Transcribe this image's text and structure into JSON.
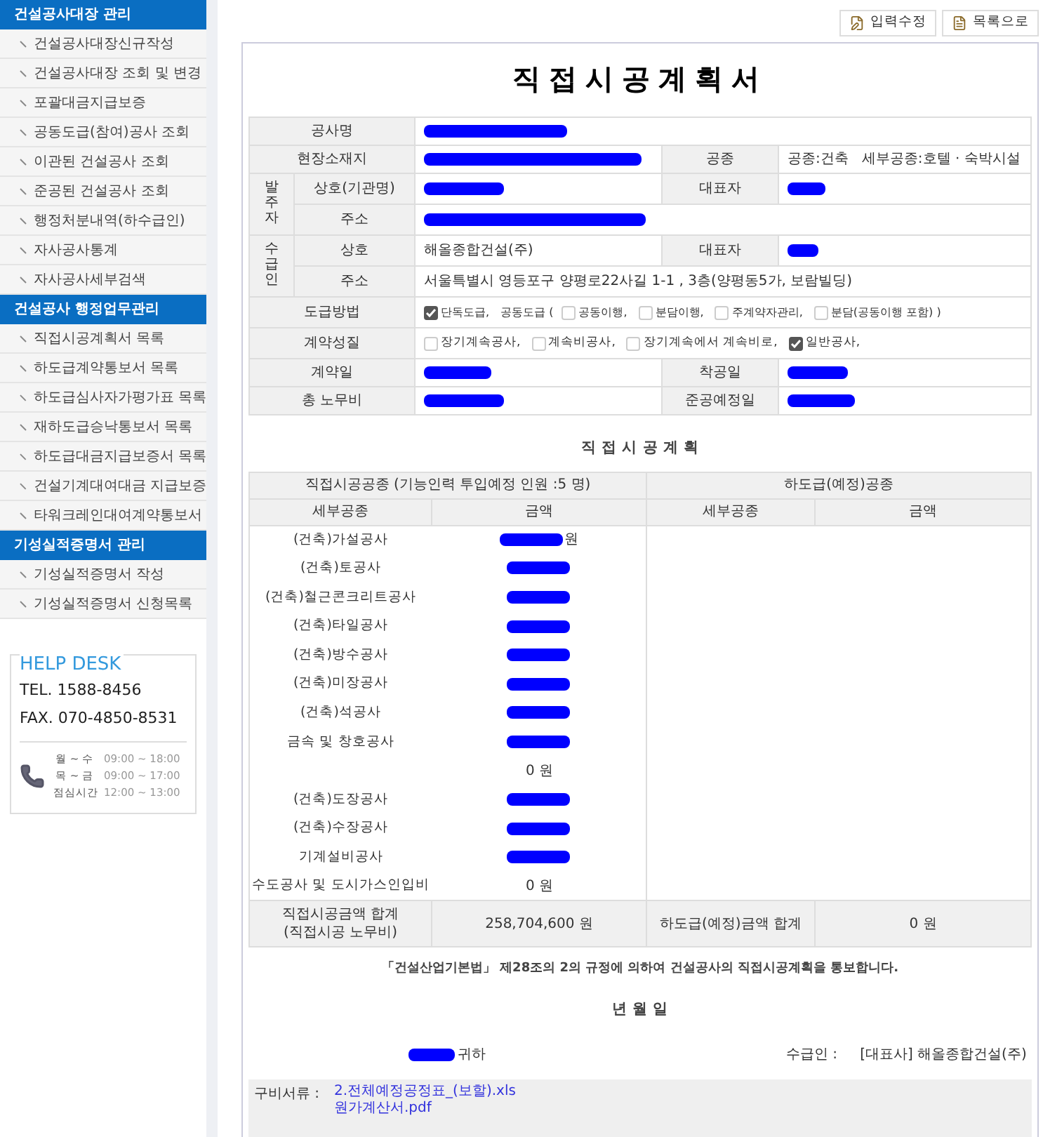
{
  "sidebar": {
    "sections": [
      {
        "title": "건설공사대장 관리",
        "items": [
          {
            "label": "건설공사대장신규작성"
          },
          {
            "label": "건설공사대장 조회 및 변경"
          },
          {
            "label": "포괄대금지급보증"
          },
          {
            "label": "공동도급(참여)공사 조회"
          },
          {
            "label": "이관된 건설공사 조회"
          },
          {
            "label": "준공된 건설공사 조회"
          },
          {
            "label": "행정처분내역(하수급인)"
          },
          {
            "label": "자사공사통계"
          },
          {
            "label": "자사공사세부검색"
          }
        ]
      },
      {
        "title": "건설공사 행정업무관리",
        "items": [
          {
            "label": "직접시공계획서 목록"
          },
          {
            "label": "하도급계약통보서 목록"
          },
          {
            "label": "하도급심사자가평가표 목록"
          },
          {
            "label": "재하도급승낙통보서 목록"
          },
          {
            "label": "하도급대금지급보증서 목록"
          },
          {
            "label": "건설기계대여대금 지급보증"
          },
          {
            "label": "타워크레인대여계약통보서"
          }
        ]
      },
      {
        "title": "기성실적증명서 관리",
        "items": [
          {
            "label": "기성실적증명서 작성"
          },
          {
            "label": "기성실적증명서 신청목록"
          }
        ]
      }
    ]
  },
  "help_desk": {
    "title": "HELP DESK",
    "tel": "TEL. 1588-8456",
    "fax": "FAX. 070-4850-8531",
    "hours": [
      {
        "days": "월 ~ 수",
        "time": "09:00 ~ 18:00"
      },
      {
        "days": "목 ~ 금",
        "time": "09:00 ~ 17:00"
      },
      {
        "days": "점심시간",
        "time": "12:00 ~ 13:00"
      }
    ]
  },
  "toolbar": {
    "buttons": [
      {
        "kind": "edit",
        "label": "입력수정"
      },
      {
        "kind": "list",
        "label": "목록으로"
      }
    ]
  },
  "document": {
    "title": "직접시공계획서",
    "info": {
      "project_name": {
        "label": "공사명"
      },
      "site": {
        "label": "현장소재지"
      },
      "work_type": {
        "label": "공종",
        "value": "공종:건축   세부공종:호텔 · 숙박시설"
      },
      "orderer": {
        "group": "발주자",
        "name_label": "상호(기관명)",
        "rep_label": "대표자",
        "address_label": "주소"
      },
      "contractor": {
        "group": "수급인",
        "name_label": "상호",
        "name": "해올종합건설(주)",
        "rep_label": "대표자",
        "address_label": "주소",
        "address": "서울특별시 영등포구 양평로22사길 1-1 , 3층(양평동5가, 보람빌딩)"
      },
      "contract_method": {
        "label": "도급방법",
        "options": [
          {
            "kind": "checkbox",
            "label": "단독도급,",
            "checked": true
          },
          {
            "kind": "text",
            "label": "공동도급 ("
          },
          {
            "kind": "checkbox",
            "label": "공동이행,",
            "checked": false
          },
          {
            "kind": "checkbox",
            "label": "분담이행,",
            "checked": false
          },
          {
            "kind": "checkbox",
            "label": "주계약자관리,",
            "checked": false
          },
          {
            "kind": "checkbox",
            "label": "분담(공동이행 포함) )",
            "checked": false
          }
        ]
      },
      "contract_nature": {
        "label": "계약성질",
        "options": [
          {
            "kind": "checkbox",
            "label": "장기계속공사,",
            "checked": false
          },
          {
            "kind": "checkbox",
            "label": "계속비공사,",
            "checked": false
          },
          {
            "kind": "checkbox",
            "label": "장기계속에서 계속비로,",
            "checked": false
          },
          {
            "kind": "checkbox",
            "label": "일반공사,",
            "checked": true
          }
        ]
      },
      "contract_date": {
        "label": "계약일"
      },
      "start_date": {
        "label": "착공일"
      },
      "labor_cost": {
        "label": "총 노무비"
      },
      "completion_date": {
        "label": "준공예정일"
      }
    },
    "plan": {
      "title": "직 접 시 공 계 획",
      "direct_header": "직접시공공종 (기능인력 투입예정 인원 :5 명)",
      "sub_header": "하도급(예정)공종",
      "columns": [
        "세부공종",
        "금액",
        "세부공종",
        "금액"
      ],
      "rows": [
        {
          "trade": "(건축)가설공사",
          "redacted": true,
          "amount": "원"
        },
        {
          "trade": "(건축)토공사",
          "redacted": true
        },
        {
          "trade": "(건축)철근콘크리트공사",
          "redacted": true
        },
        {
          "trade": "(건축)타일공사",
          "redacted": true
        },
        {
          "trade": "(건축)방수공사",
          "redacted": true
        },
        {
          "trade": "(건축)미장공사",
          "redacted": true
        },
        {
          "trade": "(건축)석공사",
          "redacted": true
        },
        {
          "trade": "금속 및 창호공사",
          "redacted": true
        },
        {
          "redacted": false,
          "amount": "0 원"
        },
        {
          "trade": "(건축)도장공사",
          "redacted": true
        },
        {
          "trade": "(건축)수장공사",
          "redacted": true
        },
        {
          "trade": "기계설비공사",
          "redacted": true
        },
        {
          "trade": "수도공사 및 도시가스인입비",
          "redacted": false,
          "amount": "0 원"
        }
      ],
      "total_label": [
        "직접시공금액 합계",
        "(직접시공 노무비)"
      ],
      "total": "258,704,600 원",
      "sub_total_label": "하도급(예정)금액 합계",
      "sub_total": "0 원"
    },
    "statement": "「건설산업기본법」 제28조의 2의 규정에 의하여 건설공사의 직접시공계획을 통보합니다.",
    "date": "년 월 일",
    "addressee_suffix": "귀하",
    "contractor_label": "수급인 :",
    "contractor_value": "[대표사] 해올종합건설(주)",
    "attachments": {
      "label": "구비서류 :",
      "files": [
        "2.전체예정공정표_(보할).xls",
        "원가계산서.pdf"
      ]
    }
  }
}
